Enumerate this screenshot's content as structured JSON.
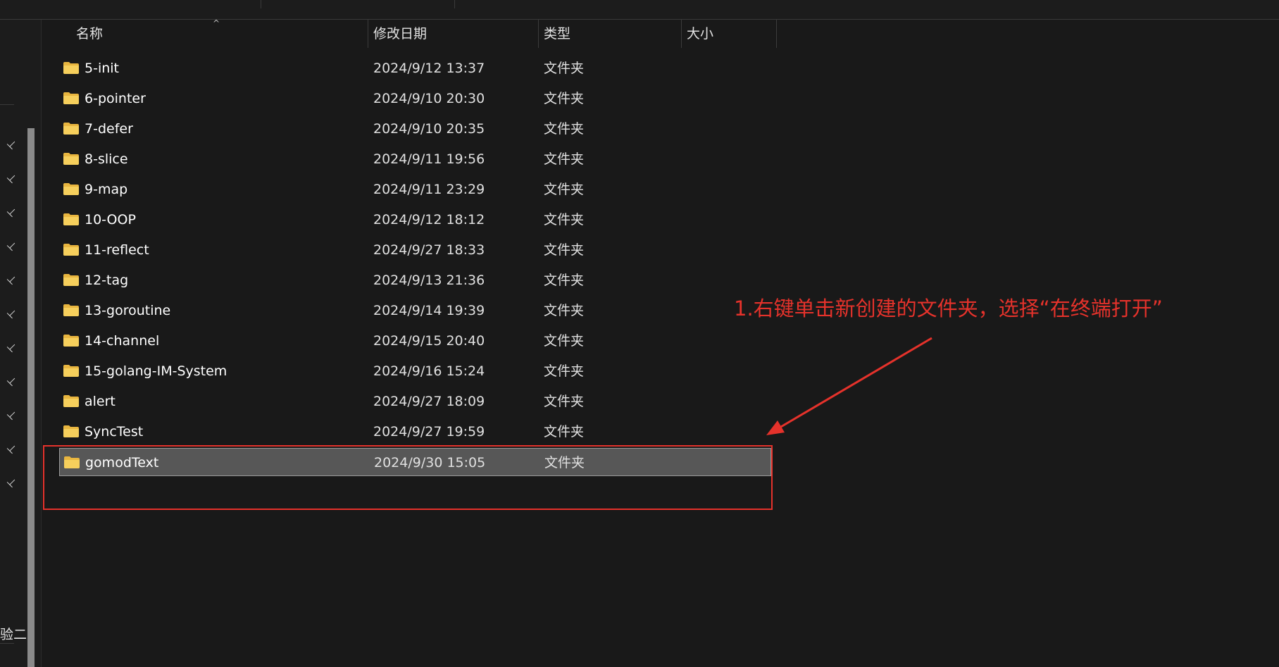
{
  "columns": {
    "name": "名称",
    "modified": "修改日期",
    "type": "类型",
    "size": "大小"
  },
  "files": [
    {
      "name": "5-init",
      "modified": "2024/9/12 13:37",
      "type": "文件夹"
    },
    {
      "name": "6-pointer",
      "modified": "2024/9/10 20:30",
      "type": "文件夹"
    },
    {
      "name": "7-defer",
      "modified": "2024/9/10 20:35",
      "type": "文件夹"
    },
    {
      "name": "8-slice",
      "modified": "2024/9/11 19:56",
      "type": "文件夹"
    },
    {
      "name": "9-map",
      "modified": "2024/9/11 23:29",
      "type": "文件夹"
    },
    {
      "name": "10-OOP",
      "modified": "2024/9/12 18:12",
      "type": "文件夹"
    },
    {
      "name": "11-reflect",
      "modified": "2024/9/27 18:33",
      "type": "文件夹"
    },
    {
      "name": "12-tag",
      "modified": "2024/9/13 21:36",
      "type": "文件夹"
    },
    {
      "name": "13-goroutine",
      "modified": "2024/9/14 19:39",
      "type": "文件夹"
    },
    {
      "name": "14-channel",
      "modified": "2024/9/15 20:40",
      "type": "文件夹"
    },
    {
      "name": "15-golang-IM-System",
      "modified": "2024/9/16 15:24",
      "type": "文件夹"
    },
    {
      "name": "alert",
      "modified": "2024/9/27 18:09",
      "type": "文件夹"
    },
    {
      "name": "SyncTest",
      "modified": "2024/9/27 19:59",
      "type": "文件夹"
    },
    {
      "name": "gomodText",
      "modified": "2024/9/30 15:05",
      "type": "文件夹",
      "selected": true
    }
  ],
  "nav": {
    "pin_icon": "pin-icon",
    "bottom_label": "验二"
  },
  "annotation": {
    "text": "1.右键单击新创建的文件夹，选择“在终端打开”",
    "color": "#e5322b"
  },
  "icons": {
    "folder": "folder-icon",
    "sort": "sort-up-icon"
  }
}
